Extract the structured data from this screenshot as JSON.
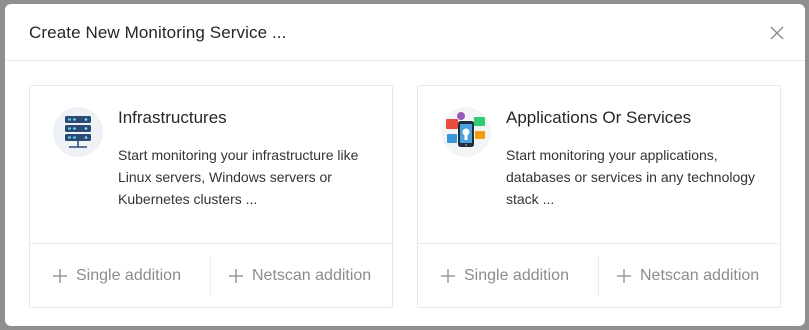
{
  "modal": {
    "title": "Create New Monitoring Service ...",
    "close_icon": "close-icon"
  },
  "cards": [
    {
      "icon": "server-rack-icon",
      "title": "Infrastructures",
      "description": "Start monitoring your infrastructure like Linux servers, Windows servers or Kubernetes clusters ...",
      "single_label": "Single addition",
      "netscan_label": "Netscan addition"
    },
    {
      "icon": "applications-icon",
      "title": "Applications Or Services",
      "description": "Start monitoring your applications, databases or services in any technology stack ...",
      "single_label": "Single addition",
      "netscan_label": "Netscan addition"
    }
  ],
  "colors": {
    "backdrop": "#8f8f8f",
    "modal_bg": "#ffffff",
    "muted_text": "#8c8c8c",
    "accent": "#1a8fc9"
  }
}
